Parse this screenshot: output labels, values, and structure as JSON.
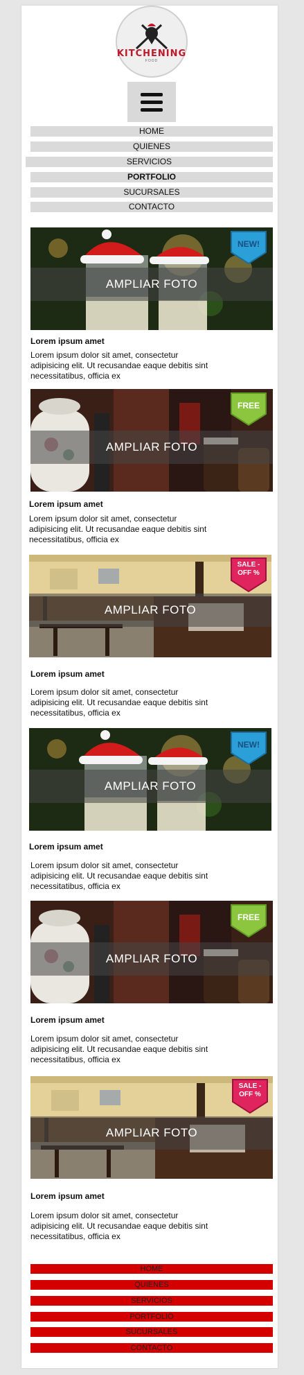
{
  "logo": {
    "name": "KITCHENING",
    "sub": "FOOD"
  },
  "menu": {
    "home": "HOME",
    "quienes": "QUIENES",
    "servicios": "SERVICIOS",
    "portfolio": "PORTFOLIO",
    "sucursales": "SUCURSALES",
    "contacto": "CONTACTO"
  },
  "cards": [
    {
      "overlay": "AMPLIAR FOTO",
      "badge": "NEW!",
      "title": "Lorem ipsum amet",
      "text": "Lorem ipsum dolor sit amet, consectetur adipisicing elit. Ut recusandae eaque debitis sint necessitatibus, officia ex"
    },
    {
      "overlay": "AMPLIAR FOTO",
      "badge": "FREE",
      "title": "Lorem ipsum amet",
      "text": "Lorem ipsum dolor sit amet, consectetur adipisicing elit. Ut recusandae eaque debitis sint necessitatibus, officia ex"
    },
    {
      "overlay": "AMPLIAR FOTO",
      "badge": "SALE - OFF %",
      "title": "Lorem ipsum amet",
      "text": "Lorem ipsum dolor sit amet, consectetur adipisicing elit. Ut recusandae eaque debitis sint necessitatibus, officia ex"
    },
    {
      "overlay": "AMPLIAR FOTO",
      "badge": "NEW!",
      "title": "Lorem ipsum amet",
      "text": "Lorem ipsum dolor sit amet, consectetur adipisicing elit. Ut recusandae eaque debitis sint necessitatibus, officia ex"
    },
    {
      "overlay": "AMPLIAR FOTO",
      "badge": "FREE",
      "title": "Lorem ipsum amet",
      "text": "Lorem ipsum dolor sit amet, consectetur adipisicing elit. Ut recusandae eaque debitis sint necessitatibus, officia ex"
    },
    {
      "overlay": "AMPLIAR FOTO",
      "badge": "SALE - OFF %",
      "title": "Lorem ipsum amet",
      "text": "Lorem ipsum dolor sit amet, consectetur adipisicing elit. Ut recusandae eaque debitis sint necessitatibus, officia ex"
    }
  ],
  "footer": {
    "home": "HOME",
    "quienes": "QUIENES",
    "servicios": "SERVICIOS",
    "portfolio": "PORTFOLIO",
    "sucursales": "SUCURSALES",
    "contacto": "CONTACTO"
  },
  "colors": {
    "brand": "#c0182a",
    "footer": "#d40000",
    "menu": "#dadada",
    "new": "#2a9fd8",
    "free": "#8cc63f",
    "sale": "#e0245e"
  }
}
